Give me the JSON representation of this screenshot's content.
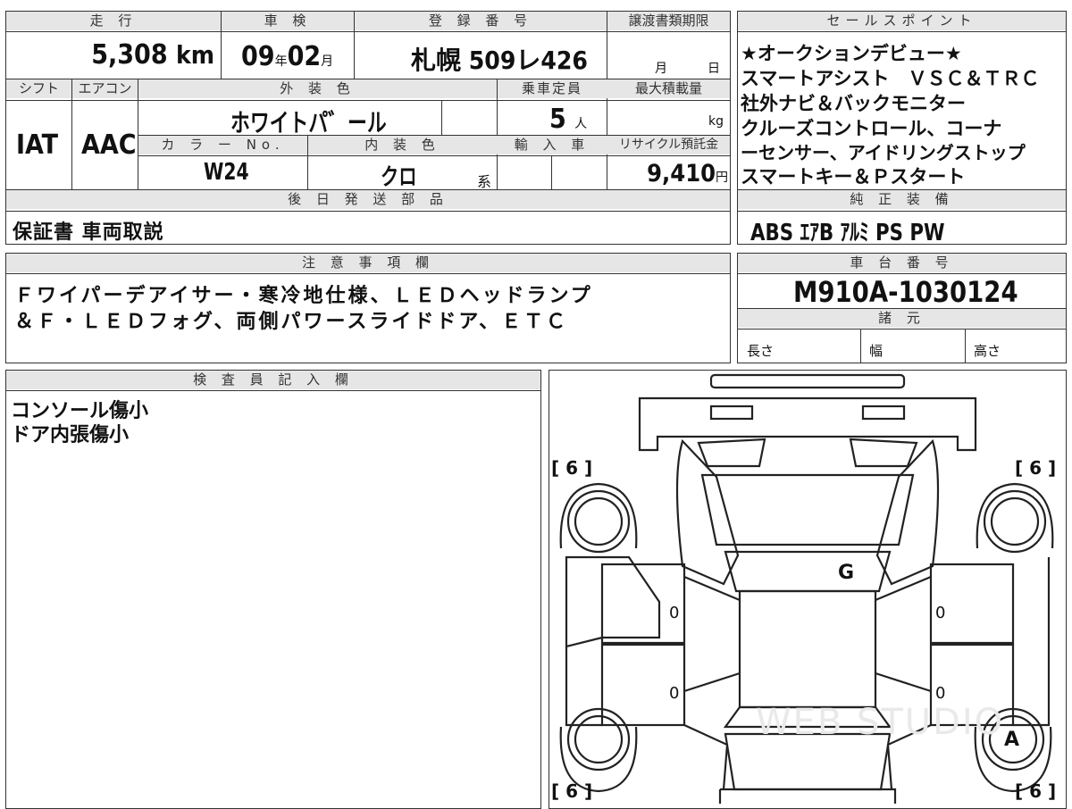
{
  "top": {
    "mileage_header": "走 行",
    "mileage_value": "5,308",
    "mileage_unit": "km",
    "inspection_header": "車 検",
    "inspection_year": "09",
    "inspection_year_unit": "年",
    "inspection_month": "02",
    "inspection_month_unit": "月",
    "registration_header": "登 録 番 号",
    "registration_value": "札幌 509レ426",
    "deadline_header": "譲渡書類期限",
    "deadline_month_unit": "月",
    "deadline_day_unit": "日"
  },
  "row2": {
    "shift_header": "シフト",
    "shift_value": "IAT",
    "ac_header": "エアコン",
    "ac_value": "AAC",
    "exterior_header": "外 装 色",
    "exterior_value": "ホワイトパ゛ール",
    "capacity_header": "乗車定員",
    "capacity_value": "5",
    "capacity_unit": "人",
    "maxload_header": "最大積載量",
    "maxload_unit": "kg",
    "color_no_header": "カ ラ ー No.",
    "color_no_value": "W24",
    "interior_header": "内 装 色",
    "interior_value": "クロ",
    "interior_unit": "系",
    "import_header": "輸 入 車",
    "recycle_header": "リサイクル預託金",
    "recycle_value": "9,410",
    "recycle_unit": "円"
  },
  "later_parts": {
    "header": "後 日 発 送 部 品",
    "value": "保証書 車両取説"
  },
  "sales": {
    "header": "セールスポイント",
    "lines": [
      "★オークションデビュー★",
      "スマートアシスト　ＶＳＣ＆ＴＲＣ",
      "社外ナビ＆バックモニター",
      "クルーズコントロール、コーナ",
      "ーセンサー、アイドリングストップ",
      "スマートキー＆Ｐスタート"
    ]
  },
  "equipment": {
    "header": "純 正 装 備",
    "items": [
      "ABS",
      "ｴｱB",
      "ｱﾙﾐ",
      "PS",
      "PW"
    ]
  },
  "notes": {
    "header": "注 意 事 項 欄",
    "lines": [
      "Ｆワイパーデアイサー・寒冷地仕様、ＬＥＤヘッドランプ",
      "＆Ｆ・ＬＥＤフォグ、両側パワースライドドア、ＥＴＣ"
    ]
  },
  "chassis": {
    "header": "車 台 番 号",
    "value": "M910A-1030124",
    "spec_header": "諸 元",
    "length_label": "長さ",
    "width_label": "幅",
    "height_label": "高さ"
  },
  "inspector": {
    "header": "検 査 員 記 入 欄",
    "lines": [
      "コンソール傷小",
      "ドア内張傷小"
    ]
  },
  "diagram": {
    "tread_fl": "6",
    "tread_fr": "6",
    "tread_rl": "6",
    "tread_rr": "6",
    "windshield_mark": "G",
    "door_marks": [
      "0",
      "0",
      "0",
      "0"
    ],
    "wheel_rr_mark": "A",
    "watermark": "WEB STUDIO"
  }
}
